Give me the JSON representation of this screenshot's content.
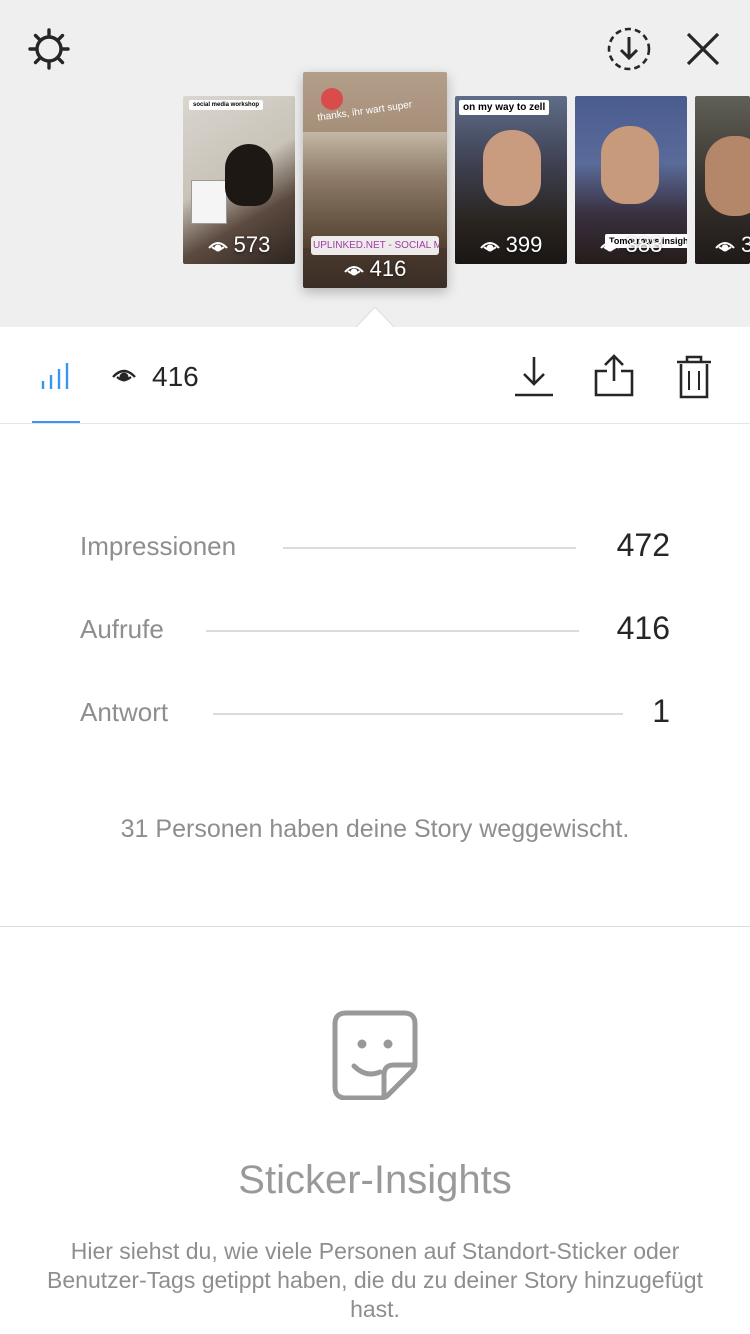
{
  "header": {
    "settings_icon": "gear-icon",
    "download_all_icon": "download-circle-icon",
    "close_icon": "close-icon"
  },
  "stories": [
    {
      "views": "573",
      "caption": "social media workshop"
    },
    {
      "views": "416",
      "caption": "thanks, ihr wart super",
      "location": "UPLINKED.NET - SOCIAL MEDIA AGENTUR",
      "selected": true
    },
    {
      "views": "399",
      "caption": "on my way to zell"
    },
    {
      "views": "383",
      "caption": "Tomorrow's insights."
    },
    {
      "views": "3"
    }
  ],
  "toolbar": {
    "view_count": "416",
    "insights_icon": "bar-chart-icon",
    "eye_icon": "eye-icon",
    "download_icon": "download-icon",
    "share_icon": "share-icon",
    "delete_icon": "trash-icon"
  },
  "metrics": [
    {
      "label": "Impressionen",
      "value": "472"
    },
    {
      "label": "Aufrufe",
      "value": "416"
    },
    {
      "label": "Antwort",
      "value": "1"
    }
  ],
  "swipe_text": "31 Personen haben deine Story weggewischt.",
  "sticker_insights": {
    "icon": "sticker-icon",
    "title": "Sticker-Insights",
    "description": "Hier siehst du, wie viele Personen auf Standort-Sticker oder Benutzer-Tags getippt haben, die du zu deiner Story hinzugefügt hast."
  },
  "colors": {
    "accent": "#3897f0",
    "text": "#262626",
    "muted": "#8e8e8e",
    "top_bg": "#efefef"
  }
}
